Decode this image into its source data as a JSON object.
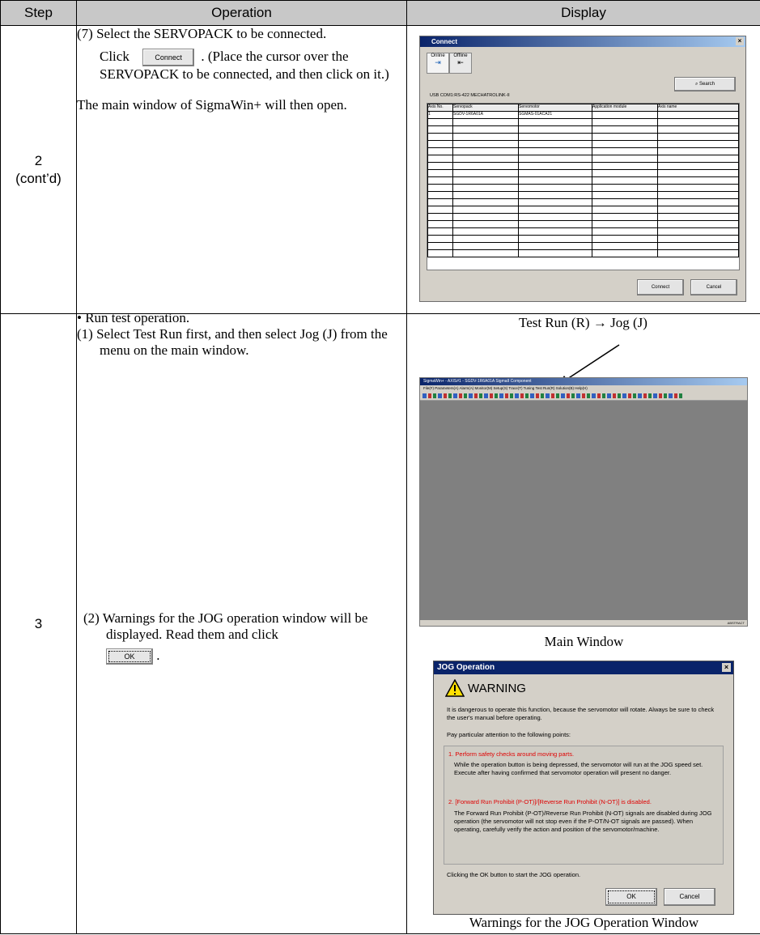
{
  "headers": {
    "step": "Step",
    "operation": "Operation",
    "display": "Display"
  },
  "row2": {
    "step_line1": "2",
    "step_line2": "(cont’d)",
    "op1": "(7) Select the SERVOPACK to be connected.",
    "op2_click": "Click",
    "op2_btn": "Connect",
    "op2_rest": ". (Place the cursor over the SERVOPACK to be connected, and then click on it.)",
    "op3": "The main window of SigmaWin+ will then open.",
    "dialog": {
      "title": "Connect",
      "online": "Online",
      "offline": "Offline",
      "search": "Search",
      "tabs": "USB   COM1:RS-422   MECHATROLINK-II",
      "columns": [
        "Axis No.",
        "Servopack",
        "Servomotor",
        "Application module",
        "Axis name"
      ],
      "row": [
        "1",
        "SGDV-1R6A01A",
        "SGMAS-01ACA21",
        "",
        ""
      ],
      "connect_btn": "Connect",
      "cancel_btn": "Cancel"
    }
  },
  "row3": {
    "step": "3",
    "bullet": "• Run test operation.",
    "op1": "(1) Select Test Run first, and then select Jog (J) from the menu on the main window.",
    "op2": "(2) Warnings for the JOG operation window will be displayed. Read them and click",
    "op2_btn": "OK",
    "annotation": "Test Run (R) → Jog (J)",
    "main_title": "SigmaWin+ - AXIS#1 - SGDV-1R6A01A SigmaII Component",
    "main_menu": "File(F)  Parameters(A)  Alarm(A)  Monitor(M)  Setup(S)  Trace(T)  Tuning  Test Run(R)  Solution(B)  Help(H)",
    "main_status": "ABSTRACT",
    "main_caption": "Main Window",
    "jog": {
      "title": "JOG Operation",
      "warning": "WARNING",
      "p1": "It is dangerous to operate this function, because the servomotor will rotate. Always be sure to check the user's manual before operating.",
      "p2": "Pay particular attention to the following points:",
      "h1": "1. Perform safety checks around moving parts.",
      "t1": "While the operation button is being depressed, the servomotor will run at the JOG speed set. Execute after having confirmed that servomotor operation will present no danger.",
      "h2": "2. [Forward Run Prohibit (P-OT)]/[Reverse Run Prohibit (N-OT)] is disabled.",
      "t2": "The Forward Run Prohibit (P-OT)/Reverse Run Prohibit (N-OT) signals are disabled during JOG operation (the servomotor will not stop even if the P-OT/N-OT signals are passed). When operating, carefully verify the action and position of the servomotor/machine.",
      "p3": "Clicking the OK button to start the JOG operation.",
      "ok": "OK",
      "cancel": "Cancel"
    },
    "jog_caption": "Warnings for the JOG Operation Window"
  }
}
